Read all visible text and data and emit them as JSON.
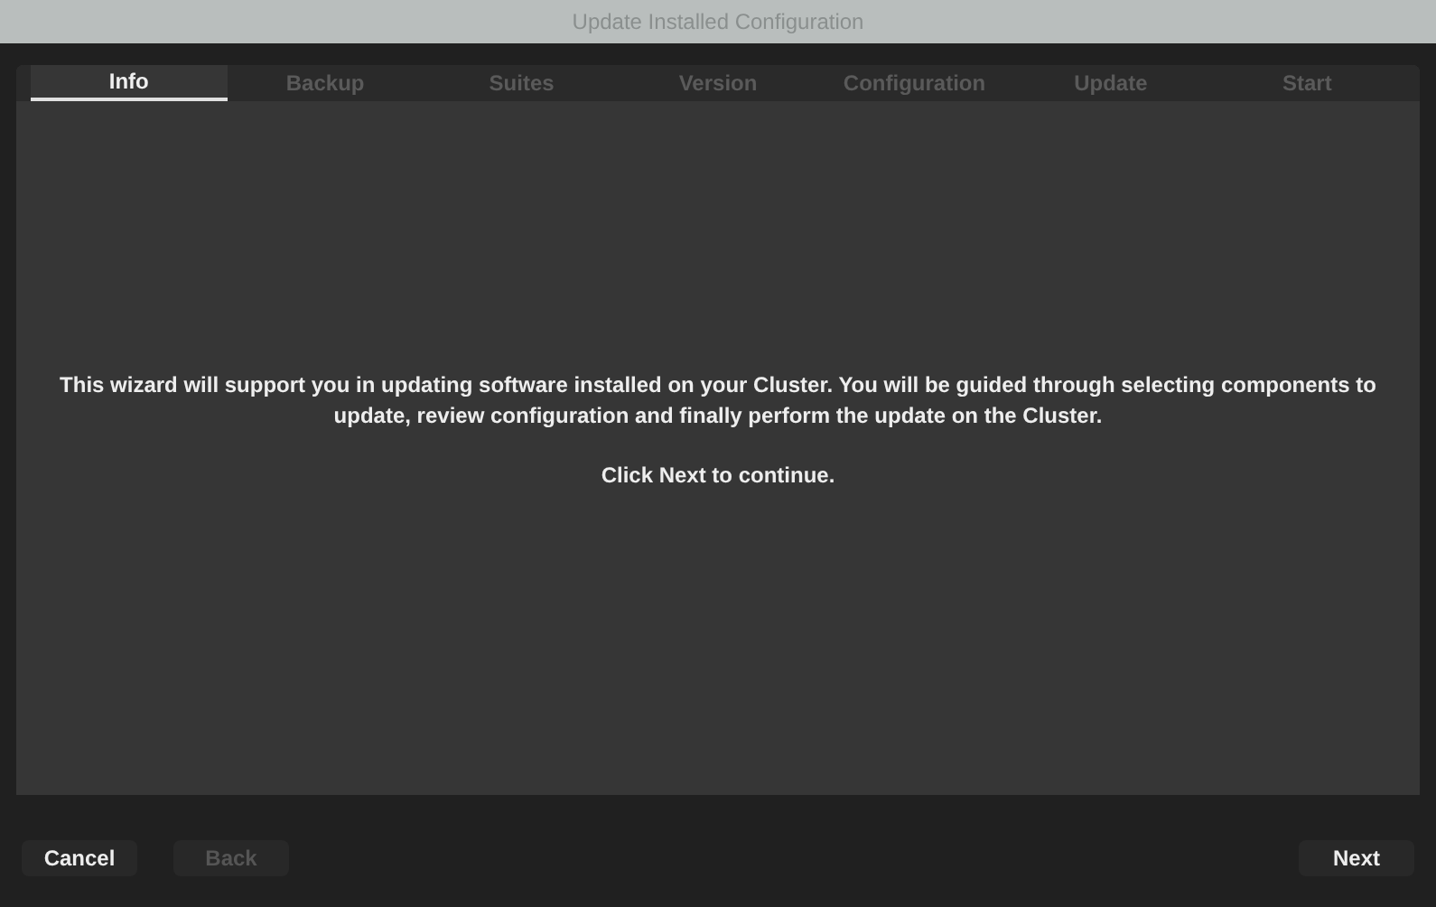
{
  "window": {
    "title": "Update Installed Configuration"
  },
  "tabs": [
    {
      "label": "Info",
      "selected": true
    },
    {
      "label": "Backup",
      "selected": false
    },
    {
      "label": "Suites",
      "selected": false
    },
    {
      "label": "Version",
      "selected": false
    },
    {
      "label": "Configuration",
      "selected": false
    },
    {
      "label": "Update",
      "selected": false
    },
    {
      "label": "Start",
      "selected": false
    }
  ],
  "message": [
    "This wizard will support you in updating software installed on your Cluster. You will be guided through selecting components to update, review configuration and finally perform the update on the Cluster.",
    "Click Next to continue."
  ],
  "buttons_left": [
    {
      "label": "Cancel",
      "disabled": false
    },
    {
      "label": "Back",
      "disabled": true
    }
  ],
  "buttons_right": [
    {
      "label": "Next",
      "disabled": false
    }
  ]
}
